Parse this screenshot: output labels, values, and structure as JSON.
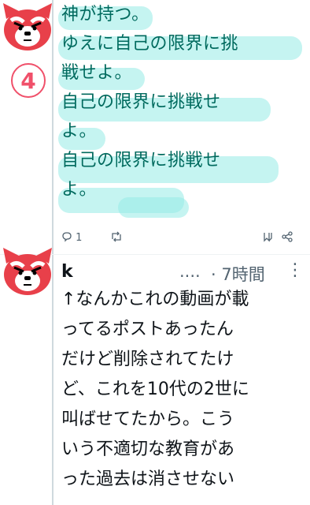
{
  "post1": {
    "lines": [
      "神が持つ。",
      "ゆえに自己の限界に挑",
      "戦せよ。",
      "自己の限界に挑戦せ",
      "よ。",
      "自己の限界に挑戦せ",
      "よ。"
    ],
    "badge_number": "4",
    "actions": {
      "reply_count": "1"
    }
  },
  "post2": {
    "author": "k",
    "dots": "....",
    "time": "· 7時間",
    "lines": [
      "↑なんかこれの動画が載",
      "ってるポストあったん",
      "だけど削除されてたけ",
      "ど、これを10代の2世に",
      "叫ばせてたから。こう",
      "いう不適切な教育があ",
      "った過去は消させない"
    ]
  },
  "colors": {
    "highlight_text": "#006a5e",
    "highlight_bg": "#96ebe6",
    "badge": "#f0506a",
    "avatar_red": "#e8404a"
  }
}
